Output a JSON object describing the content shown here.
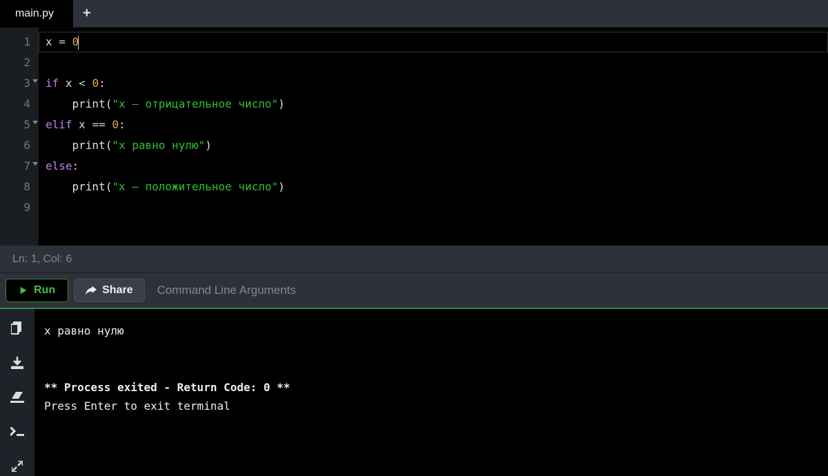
{
  "tabs": {
    "active": "main.py"
  },
  "code": {
    "lines": [
      {
        "n": "1",
        "fold": false,
        "tokens": [
          [
            "var",
            "x"
          ],
          [
            "plain",
            " "
          ],
          [
            "op",
            "="
          ],
          [
            "plain",
            " "
          ],
          [
            "num",
            "0"
          ]
        ]
      },
      {
        "n": "2",
        "fold": false,
        "tokens": []
      },
      {
        "n": "3",
        "fold": true,
        "tokens": [
          [
            "kw",
            "if"
          ],
          [
            "plain",
            " x "
          ],
          [
            "op",
            "<"
          ],
          [
            "plain",
            " "
          ],
          [
            "num",
            "0"
          ],
          [
            "plain",
            ":"
          ]
        ]
      },
      {
        "n": "4",
        "fold": false,
        "tokens": [
          [
            "plain",
            "    "
          ],
          [
            "fn",
            "print"
          ],
          [
            "paren",
            "("
          ],
          [
            "str",
            "\"x — отрицательное число\""
          ],
          [
            "paren",
            ")"
          ]
        ]
      },
      {
        "n": "5",
        "fold": true,
        "tokens": [
          [
            "kw",
            "elif"
          ],
          [
            "plain",
            " x "
          ],
          [
            "op",
            "=="
          ],
          [
            "plain",
            " "
          ],
          [
            "num",
            "0"
          ],
          [
            "plain",
            ":"
          ]
        ]
      },
      {
        "n": "6",
        "fold": false,
        "tokens": [
          [
            "plain",
            "    "
          ],
          [
            "fn",
            "print"
          ],
          [
            "paren",
            "("
          ],
          [
            "str",
            "\"x равно нулю\""
          ],
          [
            "paren",
            ")"
          ]
        ]
      },
      {
        "n": "7",
        "fold": true,
        "tokens": [
          [
            "kw",
            "else"
          ],
          [
            "plain",
            ":"
          ]
        ]
      },
      {
        "n": "8",
        "fold": false,
        "tokens": [
          [
            "plain",
            "    "
          ],
          [
            "fn",
            "print"
          ],
          [
            "paren",
            "("
          ],
          [
            "str",
            "\"x — положительное число\""
          ],
          [
            "paren",
            ")"
          ]
        ]
      },
      {
        "n": "9",
        "fold": false,
        "tokens": []
      }
    ]
  },
  "status": {
    "text": "Ln: 1,  Col: 6"
  },
  "toolbar": {
    "run_label": "Run",
    "share_label": "Share",
    "args_placeholder": "Command Line Arguments"
  },
  "terminal": {
    "lines": [
      "x равно нулю",
      "",
      "",
      "** Process exited - Return Code: 0 **",
      "Press Enter to exit terminal"
    ],
    "bold_lines": [
      3
    ]
  }
}
